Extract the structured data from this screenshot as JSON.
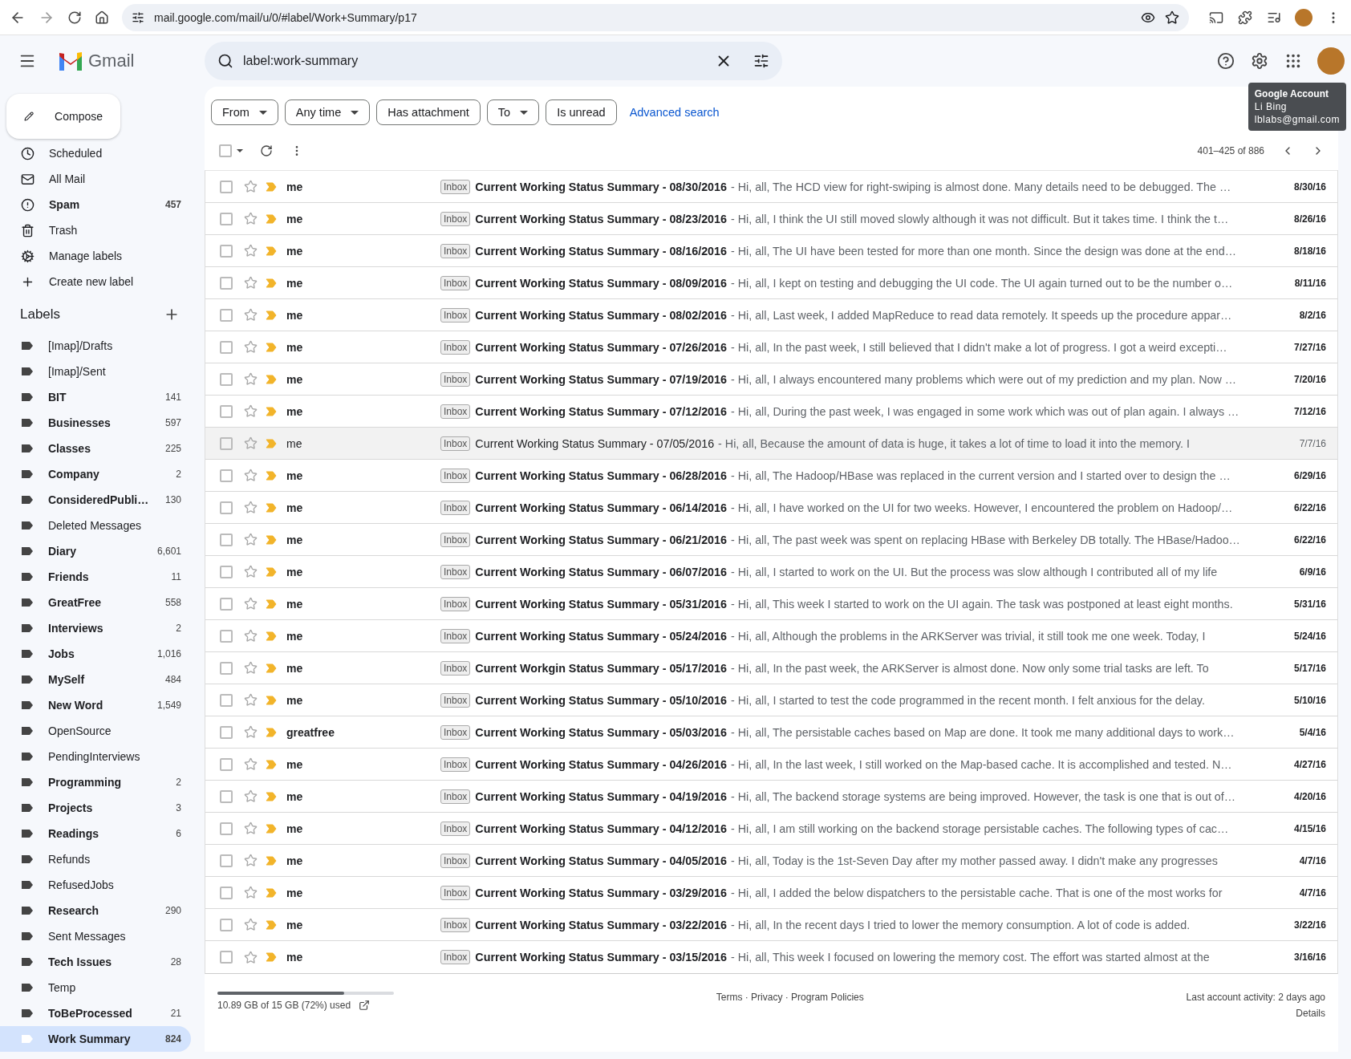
{
  "browser": {
    "url": "mail.google.com/mail/u/0/#label/Work+Summary/p17"
  },
  "app": {
    "name": "Gmail"
  },
  "search": {
    "value": "label:work-summary"
  },
  "account_tooltip": {
    "title": "Google Account",
    "name": "Li Bing",
    "email": "lblabs@gmail.com"
  },
  "compose": {
    "label": "Compose"
  },
  "nav": [
    {
      "label": "Scheduled",
      "unread": false,
      "selected": false
    },
    {
      "label": "All Mail",
      "unread": false,
      "selected": false
    },
    {
      "label": "Spam",
      "count": "457",
      "unread": true,
      "selected": false
    },
    {
      "label": "Trash",
      "unread": false,
      "selected": false
    },
    {
      "label": "Manage labels",
      "unread": false,
      "selected": false
    },
    {
      "label": "Create new label",
      "unread": false,
      "selected": false
    }
  ],
  "labels_heading": "Labels",
  "labels": [
    {
      "name": "[Imap]/Drafts",
      "unread": false,
      "selected": false
    },
    {
      "name": "[Imap]/Sent",
      "unread": false,
      "selected": false
    },
    {
      "name": "BIT",
      "count": "141",
      "unread": true,
      "selected": false
    },
    {
      "name": "Businesses",
      "count": "597",
      "unread": true,
      "selected": false
    },
    {
      "name": "Classes",
      "count": "225",
      "unread": true,
      "selected": false
    },
    {
      "name": "Company",
      "count": "2",
      "unread": true,
      "selected": false
    },
    {
      "name": "ConsideredPubli…",
      "count": "130",
      "unread": true,
      "selected": false
    },
    {
      "name": "Deleted Messages",
      "unread": false,
      "selected": false
    },
    {
      "name": "Diary",
      "count": "6,601",
      "unread": true,
      "selected": false
    },
    {
      "name": "Friends",
      "count": "11",
      "unread": true,
      "selected": false
    },
    {
      "name": "GreatFree",
      "count": "558",
      "unread": true,
      "selected": false
    },
    {
      "name": "Interviews",
      "count": "2",
      "unread": true,
      "selected": false
    },
    {
      "name": "Jobs",
      "count": "1,016",
      "unread": true,
      "selected": false
    },
    {
      "name": "MySelf",
      "count": "484",
      "unread": true,
      "selected": false
    },
    {
      "name": "New Word",
      "count": "1,549",
      "unread": true,
      "selected": false
    },
    {
      "name": "OpenSource",
      "unread": false,
      "selected": false
    },
    {
      "name": "PendingInterviews",
      "unread": false,
      "selected": false
    },
    {
      "name": "Programming",
      "count": "2",
      "unread": true,
      "selected": false
    },
    {
      "name": "Projects",
      "count": "3",
      "unread": true,
      "selected": false
    },
    {
      "name": "Readings",
      "count": "6",
      "unread": true,
      "selected": false
    },
    {
      "name": "Refunds",
      "unread": false,
      "selected": false
    },
    {
      "name": "RefusedJobs",
      "unread": false,
      "selected": false
    },
    {
      "name": "Research",
      "count": "290",
      "unread": true,
      "selected": false
    },
    {
      "name": "Sent Messages",
      "unread": false,
      "selected": false
    },
    {
      "name": "Tech Issues",
      "count": "28",
      "unread": true,
      "selected": false
    },
    {
      "name": "Temp",
      "unread": false,
      "selected": false
    },
    {
      "name": "ToBeProcessed",
      "count": "21",
      "unread": true,
      "selected": false
    },
    {
      "name": "Work Summary",
      "count": "824",
      "unread": true,
      "selected": true
    }
  ],
  "filters": [
    {
      "label": "From",
      "dropdown": true
    },
    {
      "label": "Any time",
      "dropdown": true
    },
    {
      "label": "Has attachment",
      "dropdown": false
    },
    {
      "label": "To",
      "dropdown": true
    },
    {
      "label": "Is unread",
      "dropdown": false
    }
  ],
  "advanced_search": "Advanced search",
  "select_all": {
    "checked": false
  },
  "pagination": {
    "range": "401–425 of 886"
  },
  "emails": [
    {
      "sender": "me",
      "tag": "Inbox",
      "subject": "Current Working Status Summary - 08/30/2016",
      "snippet": "- Hi, all, The HCD view for right-swiping is almost done. Many details need to be debugged. The …",
      "date": "8/30/16",
      "unread": true,
      "checked": false,
      "starred": false,
      "important": true
    },
    {
      "sender": "me",
      "tag": "Inbox",
      "subject": "Current Working Status Summary - 08/23/2016",
      "snippet": "- Hi, all, I think the UI still moved slowly although it was not difficult. But it takes time. I think the t…",
      "date": "8/26/16",
      "unread": true,
      "checked": false,
      "starred": false,
      "important": true
    },
    {
      "sender": "me",
      "tag": "Inbox",
      "subject": "Current Working Status Summary - 08/16/2016",
      "snippet": "- Hi, all, The UI have been tested for more than one month. Since the design was done at the end…",
      "date": "8/18/16",
      "unread": true,
      "checked": false,
      "starred": false,
      "important": true
    },
    {
      "sender": "me",
      "tag": "Inbox",
      "subject": "Current Working Status Summary - 08/09/2016",
      "snippet": "- Hi, all, I kept on testing and debugging the UI code. The UI again turned out to be the number o…",
      "date": "8/11/16",
      "unread": true,
      "checked": false,
      "starred": false,
      "important": true
    },
    {
      "sender": "me",
      "tag": "Inbox",
      "subject": "Current Working Status Summary - 08/02/2016",
      "snippet": "- Hi, all, Last week, I added MapReduce to read data remotely. It speeds up the procedure appar…",
      "date": "8/2/16",
      "unread": true,
      "checked": false,
      "starred": false,
      "important": true
    },
    {
      "sender": "me",
      "tag": "Inbox",
      "subject": "Current Working Status Summary - 07/26/2016",
      "snippet": "- Hi, all, In the past week, I still believed that I didn't make a lot of progress. I got a weird excepti…",
      "date": "7/27/16",
      "unread": true,
      "checked": false,
      "starred": false,
      "important": true
    },
    {
      "sender": "me",
      "tag": "Inbox",
      "subject": "Current Working Status Summary - 07/19/2016",
      "snippet": "- Hi, all, I always encountered many problems which were out of my prediction and my plan. Now …",
      "date": "7/20/16",
      "unread": true,
      "checked": false,
      "starred": false,
      "important": true
    },
    {
      "sender": "me",
      "tag": "Inbox",
      "subject": "Current Working Status Summary - 07/12/2016",
      "snippet": "- Hi, all, During the past week, I was engaged in some work which was out of plan again. I always …",
      "date": "7/12/16",
      "unread": true,
      "checked": false,
      "starred": false,
      "important": true
    },
    {
      "sender": "me",
      "tag": "Inbox",
      "subject": "Current Working Status Summary - 07/05/2016",
      "snippet": "- Hi, all, Because the amount of data is huge, it takes a lot of time to load it into the memory. I",
      "date": "7/7/16",
      "unread": false,
      "checked": false,
      "starred": false,
      "important": true
    },
    {
      "sender": "me",
      "tag": "Inbox",
      "subject": "Current Working Status Summary - 06/28/2016",
      "snippet": "- Hi, all, The Hadoop/HBase was replaced in the current version and I started over to design the …",
      "date": "6/29/16",
      "unread": true,
      "checked": false,
      "starred": false,
      "important": true
    },
    {
      "sender": "me",
      "tag": "Inbox",
      "subject": "Current Working Status Summary - 06/14/2016",
      "snippet": "- Hi, all, I have worked on the UI for two weeks. However, I encountered the problem on Hadoop/…",
      "date": "6/22/16",
      "unread": true,
      "checked": false,
      "starred": false,
      "important": true
    },
    {
      "sender": "me",
      "tag": "Inbox",
      "subject": "Current Working Status Summary - 06/21/2016",
      "snippet": "- Hi, all, The past week was spent on replacing HBase with Berkeley DB totally. The HBase/Hadoo…",
      "date": "6/22/16",
      "unread": true,
      "checked": false,
      "starred": false,
      "important": true
    },
    {
      "sender": "me",
      "tag": "Inbox",
      "subject": "Current Working Status Summary - 06/07/2016",
      "snippet": "- Hi, all, I started to work on the UI. But the process was slow although I contributed all of my life",
      "date": "6/9/16",
      "unread": true,
      "checked": false,
      "starred": false,
      "important": true
    },
    {
      "sender": "me",
      "tag": "Inbox",
      "subject": "Current Working Status Summary - 05/31/2016",
      "snippet": "- Hi, all, This week I started to work on the UI again. The task was postponed at least eight months.",
      "date": "5/31/16",
      "unread": true,
      "checked": false,
      "starred": false,
      "important": true
    },
    {
      "sender": "me",
      "tag": "Inbox",
      "subject": "Current Working Status Summary - 05/24/2016",
      "snippet": "- Hi, all, Although the problems in the ARKServer was trivial, it still took me one week. Today, I",
      "date": "5/24/16",
      "unread": true,
      "checked": false,
      "starred": false,
      "important": true
    },
    {
      "sender": "me",
      "tag": "Inbox",
      "subject": "Current Workgin Status Summary - 05/17/2016",
      "snippet": "- Hi, all, In the past week, the ARKServer is almost done. Now only some trial tasks are left. To",
      "date": "5/17/16",
      "unread": true,
      "checked": false,
      "starred": false,
      "important": true
    },
    {
      "sender": "me",
      "tag": "Inbox",
      "subject": "Current Working Status Summary - 05/10/2016",
      "snippet": "- Hi, all, I started to test the code programmed in the recent month. I felt anxious for the delay.",
      "date": "5/10/16",
      "unread": true,
      "checked": false,
      "starred": false,
      "important": true
    },
    {
      "sender": "greatfree",
      "tag": "Inbox",
      "subject": "Current Working Status Summary - 05/03/2016",
      "snippet": "- Hi, all, The persistable caches based on Map are done. It took me many additional days to work…",
      "date": "5/4/16",
      "unread": true,
      "checked": false,
      "starred": false,
      "important": true
    },
    {
      "sender": "me",
      "tag": "Inbox",
      "subject": "Current Working Status Summary - 04/26/2016",
      "snippet": "- Hi, all, In the last week, I still worked on the Map-based cache. It is accomplished and tested. N…",
      "date": "4/27/16",
      "unread": true,
      "checked": false,
      "starred": false,
      "important": true
    },
    {
      "sender": "me",
      "tag": "Inbox",
      "subject": "Current Working Status Summary - 04/19/2016",
      "snippet": "- Hi, all, The backend storage systems are being improved. However, the task is one that is out of…",
      "date": "4/20/16",
      "unread": true,
      "checked": false,
      "starred": false,
      "important": true
    },
    {
      "sender": "me",
      "tag": "Inbox",
      "subject": "Current Working Status Summary - 04/12/2016",
      "snippet": "- Hi, all, I am still working on the backend storage persistable caches. The following types of cac…",
      "date": "4/15/16",
      "unread": true,
      "checked": false,
      "starred": false,
      "important": true
    },
    {
      "sender": "me",
      "tag": "Inbox",
      "subject": "Current Working Status Summary - 04/05/2016",
      "snippet": "- Hi, all, Today is the 1st-Seven Day after my mother passed away. I didn't make any progresses",
      "date": "4/7/16",
      "unread": true,
      "checked": false,
      "starred": false,
      "important": true
    },
    {
      "sender": "me",
      "tag": "Inbox",
      "subject": "Current Working Status Summary - 03/29/2016",
      "snippet": "- Hi, all, I added the below dispatchers to the persistable cache. That is one of the most works for",
      "date": "4/7/16",
      "unread": true,
      "checked": false,
      "starred": false,
      "important": true
    },
    {
      "sender": "me",
      "tag": "Inbox",
      "subject": "Current Working Status Summary - 03/22/2016",
      "snippet": "- Hi, all, In the recent days I tried to lower the memory consumption. A lot of code is added.",
      "date": "3/22/16",
      "unread": true,
      "checked": false,
      "starred": false,
      "important": true
    },
    {
      "sender": "me",
      "tag": "Inbox",
      "subject": "Current Working Status Summary - 03/15/2016",
      "snippet": "- Hi, all, This week I focused on lowering the memory cost. The effort was started almost at the",
      "date": "3/16/16",
      "unread": true,
      "checked": false,
      "starred": false,
      "important": true
    }
  ],
  "footer": {
    "storage": {
      "level": 0.72,
      "text": "10.89 GB of 15 GB (72%) used"
    },
    "links": "Terms · Privacy · Program Policies",
    "activity": "Last account activity: 2 days ago",
    "details": "Details"
  }
}
